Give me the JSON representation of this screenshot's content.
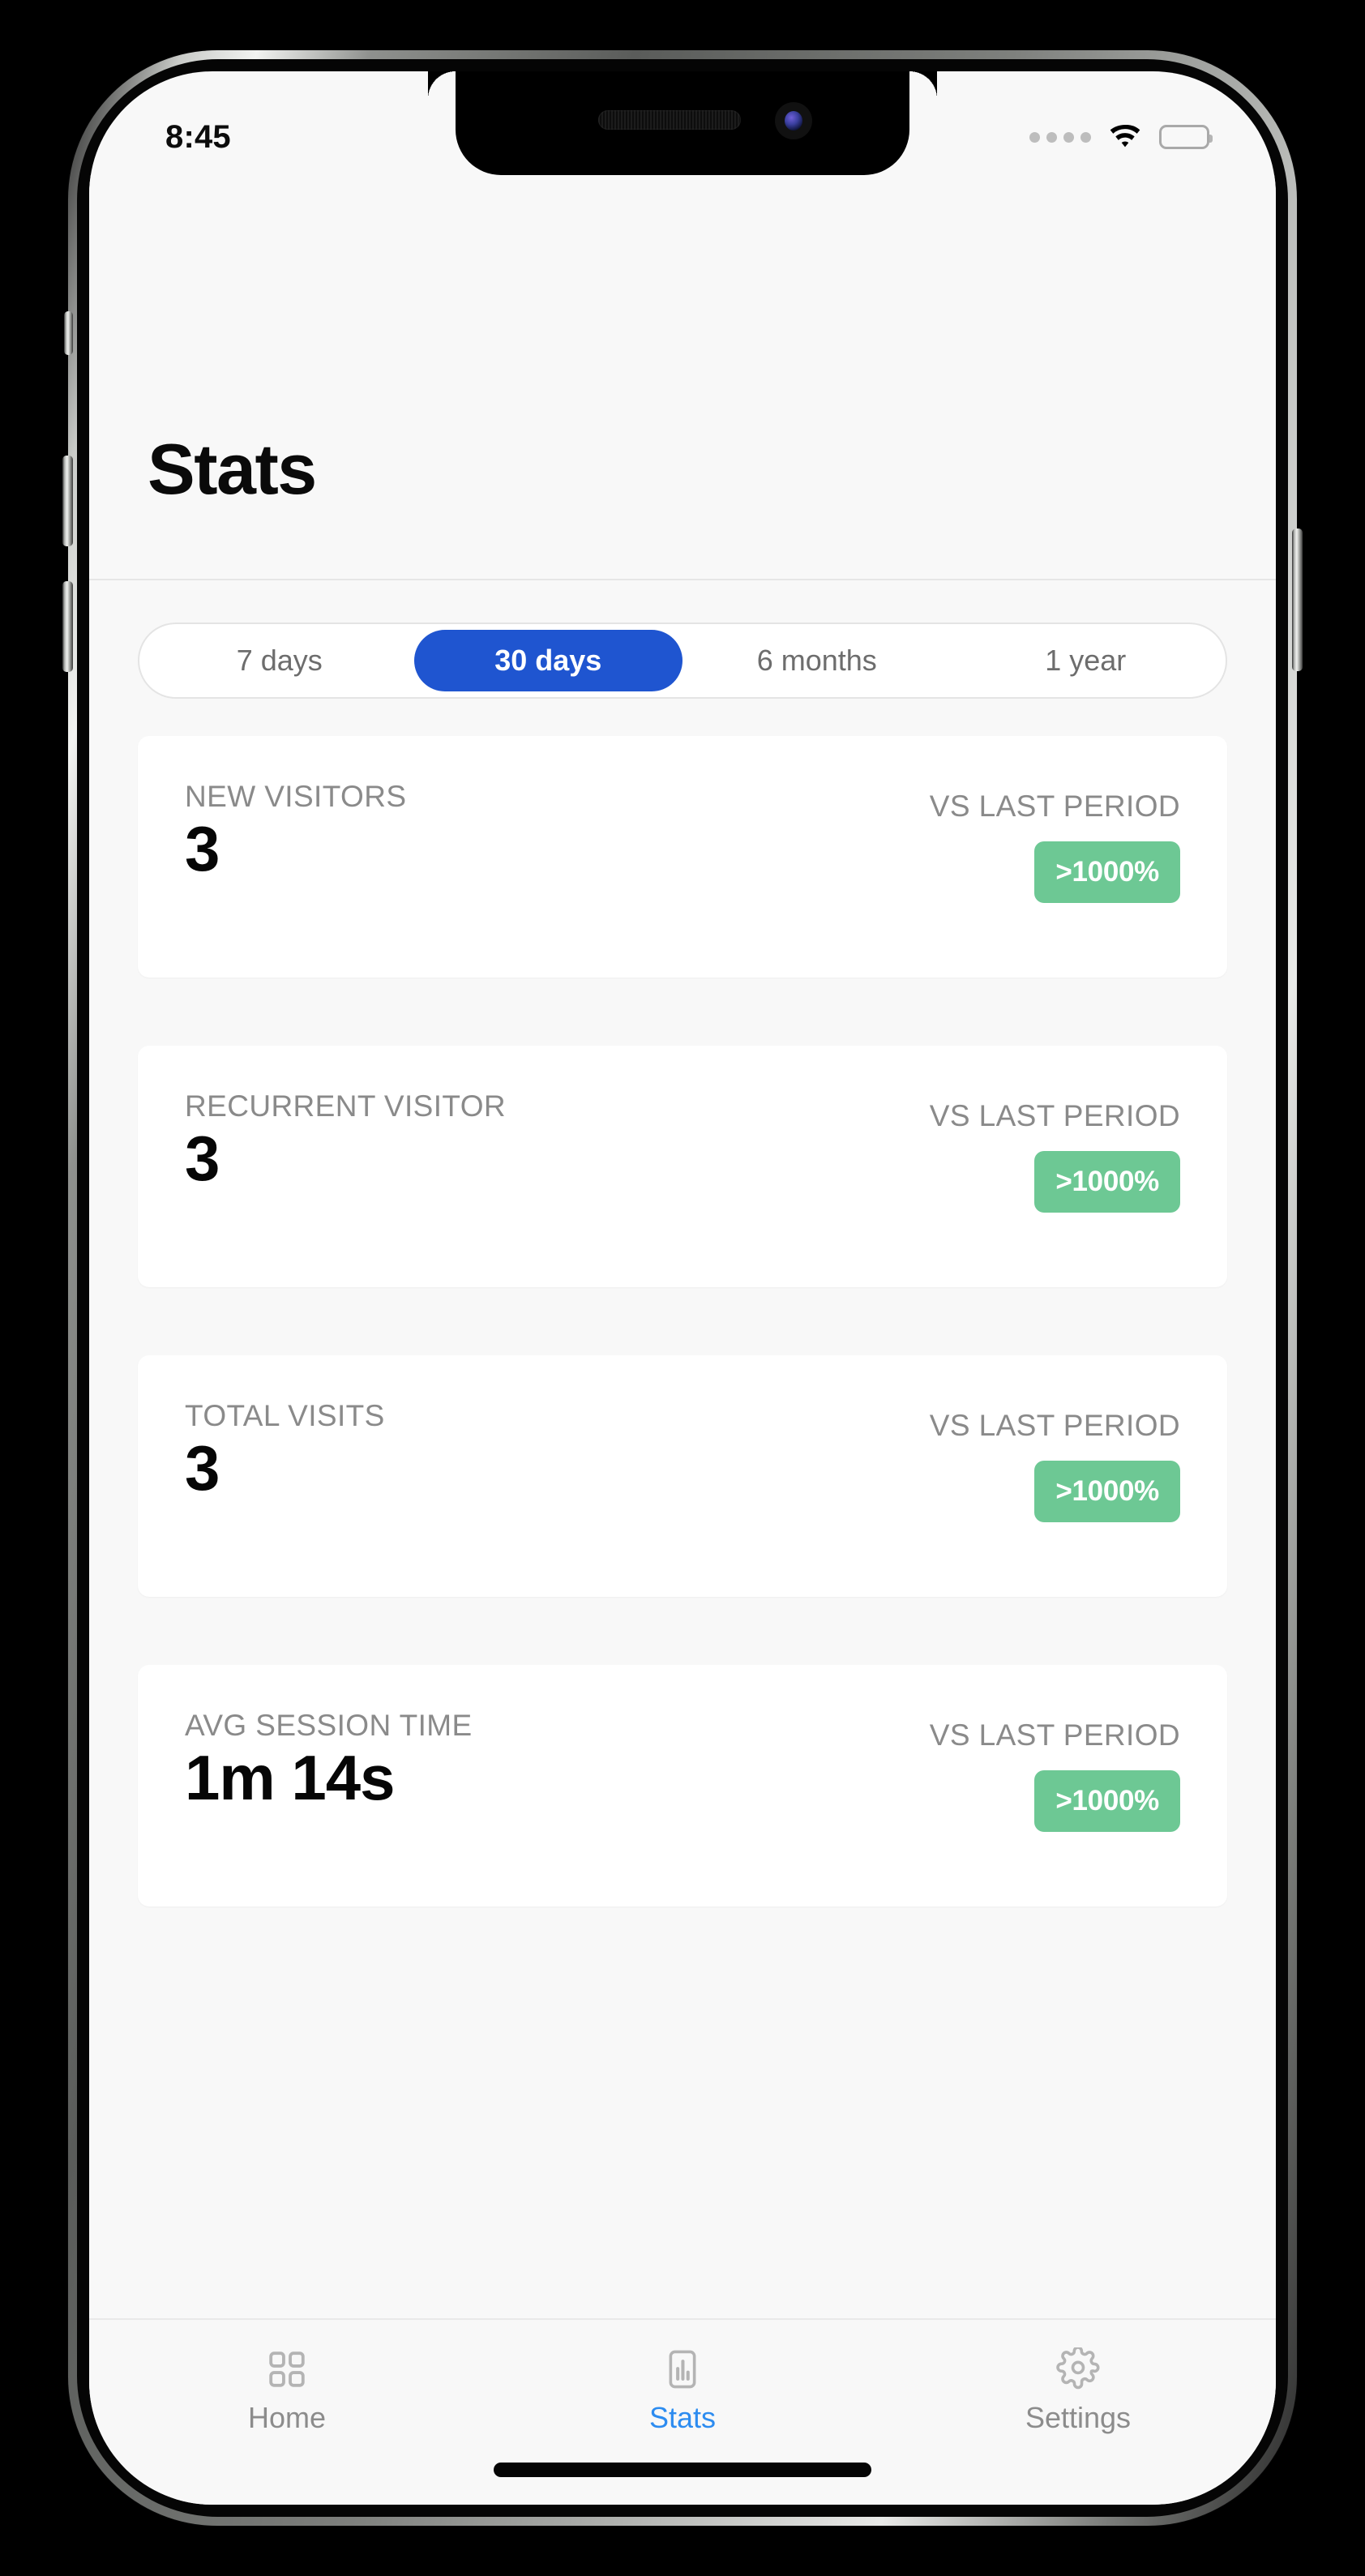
{
  "status_bar": {
    "time": "8:45",
    "signal_icon": "cellular-dots-icon",
    "wifi_icon": "wifi-icon",
    "battery_icon": "battery-full-icon"
  },
  "header": {
    "title": "Stats"
  },
  "segmented_control": {
    "options": [
      {
        "label": "7 days",
        "selected": false
      },
      {
        "label": "30 days",
        "selected": true
      },
      {
        "label": "6 months",
        "selected": false
      },
      {
        "label": "1 year",
        "selected": false
      }
    ],
    "selected_value": "30 days",
    "accent_color": "#1f55d0"
  },
  "stats": {
    "comparison_label": "VS LAST PERIOD",
    "badge_color": "#6dc894",
    "cards": [
      {
        "label": "NEW VISITORS",
        "value": "3",
        "vs_label": "VS LAST PERIOD",
        "badge": ">1000%"
      },
      {
        "label": "RECURRENT VISITOR",
        "value": "3",
        "vs_label": "VS LAST PERIOD",
        "badge": ">1000%"
      },
      {
        "label": "TOTAL VISITS",
        "value": "3",
        "vs_label": "VS LAST PERIOD",
        "badge": ">1000%"
      },
      {
        "label": "AVG SESSION TIME",
        "value": "1m 14s",
        "vs_label": "VS LAST PERIOD",
        "badge": ">1000%"
      }
    ]
  },
  "tab_bar": {
    "active_color": "#2d8cf0",
    "tabs": [
      {
        "label": "Home",
        "icon": "grid-icon",
        "active": false
      },
      {
        "label": "Stats",
        "icon": "bar-chart-icon",
        "active": true
      },
      {
        "label": "Settings",
        "icon": "gear-icon",
        "active": false
      }
    ]
  }
}
